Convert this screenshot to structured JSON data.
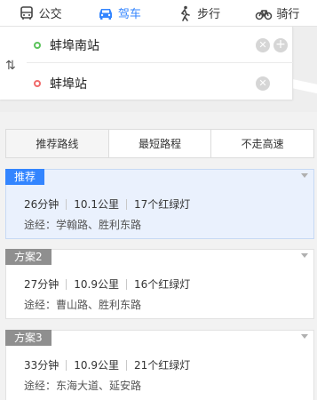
{
  "modes": [
    {
      "label": "公交",
      "icon": "bus-icon"
    },
    {
      "label": "驾车",
      "icon": "car-icon",
      "active": true
    },
    {
      "label": "步行",
      "icon": "walk-icon"
    },
    {
      "label": "骑行",
      "icon": "bike-icon"
    }
  ],
  "route": {
    "start": "蚌埠南站",
    "end": "蚌埠站"
  },
  "strategy": {
    "recommended": "推荐路线",
    "shortest": "最短路程",
    "no_highway": "不走高速"
  },
  "plans": [
    {
      "tag": "推荐",
      "time": "26分钟",
      "distance": "10.1公里",
      "lights": "17个红绿灯",
      "via": "途经：学翰路、胜利东路"
    },
    {
      "tag": "方案2",
      "time": "27分钟",
      "distance": "10.9公里",
      "lights": "16个红绿灯",
      "via": "途经：曹山路、胜利东路"
    },
    {
      "tag": "方案3",
      "time": "33分钟",
      "distance": "10.9公里",
      "lights": "21个红绿灯",
      "via": "途经：东海大道、延安路"
    }
  ],
  "colors": {
    "accent": "#3385ff",
    "start_dot": "#5cc35c",
    "end_dot": "#f06b6b"
  }
}
